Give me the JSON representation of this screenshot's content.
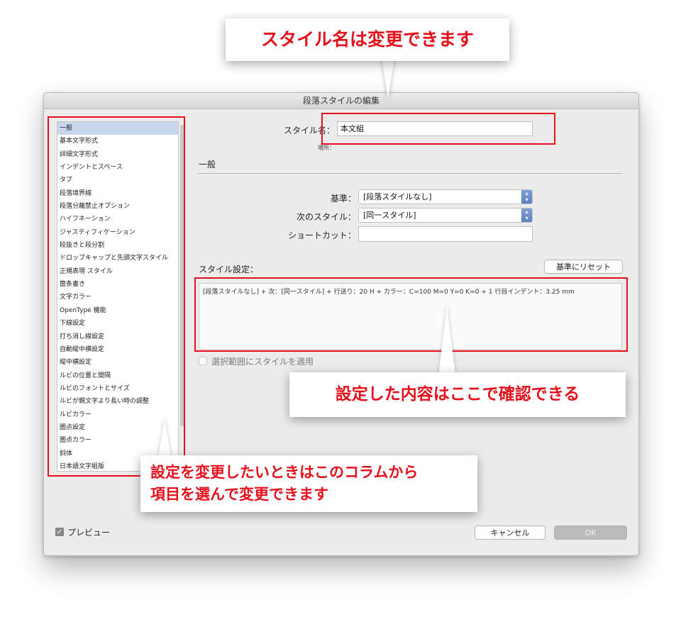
{
  "dialog": {
    "title": "段落スタイルの編集"
  },
  "sidebar": {
    "items": [
      "一般",
      "基本文字形式",
      "詳細文字形式",
      "インデントとスペース",
      "タブ",
      "段落境界線",
      "段落分離禁止オプション",
      "ハイフネーション",
      "ジャスティフィケーション",
      "段抜きと段分割",
      "ドロップキャップと先頭文字スタイル",
      "正規表現 スタイル",
      "箇条書き",
      "文字カラー",
      "OpenType 機能",
      "下線設定",
      "打ち消し線設定",
      "自動縦中横設定",
      "縦中横設定",
      "ルビの位置と間隔",
      "ルビのフォントとサイズ",
      "ルビが親文字より長い時の調整",
      "ルビカラー",
      "圏点設定",
      "圏点カラー",
      "斜体",
      "日本語文字組版"
    ],
    "selected_index": 0
  },
  "form": {
    "style_name_label": "スタイル名：",
    "style_name_value": "本文組",
    "location_label": "場所：",
    "section_title": "一般",
    "based_on_label": "基準：",
    "based_on_value": "[段落スタイルなし]",
    "next_style_label": "次のスタイル：",
    "next_style_value": "[同一スタイル]",
    "shortcut_label": "ショートカット：",
    "shortcut_value": "",
    "style_settings_label": "スタイル設定：",
    "reset_button": "基準にリセット",
    "summary_text": "[段落スタイルなし] + 次：[同一スタイル] + 行送り：20 H + カラー：C=100 M=0 Y=0 K=0 + 1 行目インデント：3.25 mm",
    "apply_label": "選択範囲にスタイルを適用"
  },
  "footer": {
    "preview_label": "プレビュー",
    "cancel_button": "キャンセル",
    "ok_button": "OK"
  },
  "callouts": {
    "top": "スタイル名は変更できます",
    "middle": "設定した内容はここで確認できる",
    "bottom_line1": "設定を変更したいときはこのコラムから",
    "bottom_line2": "項目を選んで変更できます"
  },
  "colors": {
    "annotation_red": "#e5101b",
    "selection": "#c7d7ee",
    "select_arrow": "#5b7fc2"
  }
}
